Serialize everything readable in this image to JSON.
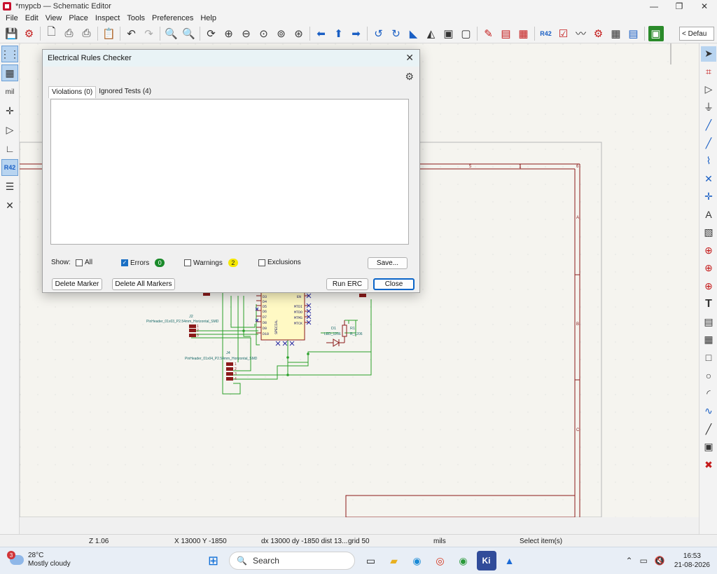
{
  "window": {
    "title": "*mypcb — Schematic Editor",
    "minimize": "—",
    "maximize": "❐",
    "close": "✕"
  },
  "menu": [
    "File",
    "Edit",
    "View",
    "Place",
    "Inspect",
    "Tools",
    "Preferences",
    "Help"
  ],
  "toolbar": {
    "unit_selector": "< Defau"
  },
  "dialog": {
    "title": "Electrical Rules Checker",
    "close": "✕",
    "tabs": [
      "Violations (0)",
      "Ignored Tests (4)"
    ],
    "show_label": "Show:",
    "filters": {
      "all": {
        "label": "All",
        "checked": false
      },
      "errors": {
        "label": "Errors",
        "checked": true,
        "count": "0",
        "color": "#1a8a2a"
      },
      "warnings": {
        "label": "Warnings",
        "checked": false,
        "count": "2",
        "color": "#f5e800"
      },
      "exclusions": {
        "label": "Exclusions",
        "checked": false
      }
    },
    "buttons": {
      "save": "Save...",
      "delete_marker": "Delete Marker",
      "delete_all_markers": "Delete All Markers",
      "run_erc": "Run ERC",
      "close": "Close"
    }
  },
  "schematic": {
    "border_row_labels": [
      "A",
      "B",
      "C"
    ],
    "border_col_labels": [
      "5",
      "1",
      "6"
    ],
    "j2_ref": "J2",
    "j2_value": "PinHeader_01x03_P2.54mm_Horizontal_SMD",
    "j2_pins": [
      "1",
      "2",
      "3"
    ],
    "j4_ref": "J4",
    "j4_value": "PinHeader_01x04_P2.54mm_Horizontal_SMD",
    "j4_pins": [
      "1",
      "2",
      "3",
      "4"
    ],
    "d1_ref": "D1",
    "d1_value": "LED_1206",
    "r1_ref": "R1",
    "r1_value": "R_1206",
    "mcu_pins_left": [
      "D3",
      "D4",
      "D5",
      "D6",
      "D7",
      "D8",
      "D9",
      "D10"
    ],
    "mcu_pins_right": [
      "EN",
      "MTDI",
      "MTDO",
      "MTMS",
      "MTCK"
    ],
    "mcu_bottom_text": "SPECIAL",
    "wire_color": "#2aa02a",
    "border_color": "#8b1a1a"
  },
  "status": {
    "zoom": "Z 1.06",
    "coords": "X 13000  Y -1850",
    "delta": "dx 13000  dy -1850  dist 13...",
    "grid": "grid 50",
    "units": "mils",
    "selection": "Select item(s)"
  },
  "taskbar": {
    "temperature": "28°C",
    "weather": "Mostly cloudy",
    "weather_badge": "3",
    "search_placeholder": "Search",
    "time": "16:53",
    "date": "21-08-2026"
  }
}
